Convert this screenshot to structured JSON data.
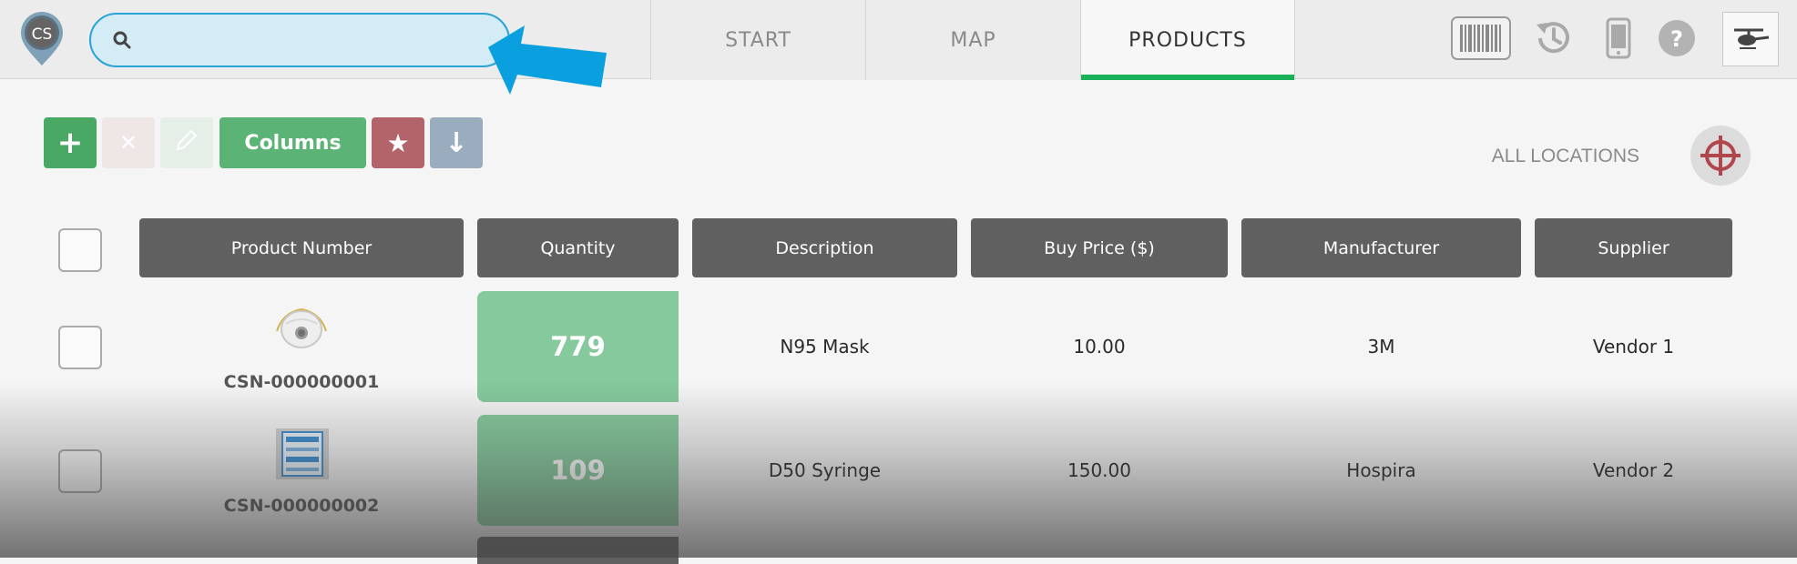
{
  "app": {
    "logo_text": "CS"
  },
  "search": {
    "placeholder": "",
    "value": ""
  },
  "tabs": [
    {
      "label": "START",
      "active": false
    },
    {
      "label": "MAP",
      "active": false
    },
    {
      "label": "PRODUCTS",
      "active": true
    }
  ],
  "header_icons": [
    "barcode-icon",
    "history-icon",
    "mobile-device-icon",
    "help-icon",
    "helicopter-icon"
  ],
  "toolbar": {
    "add_icon": "+",
    "delete_icon": "✕",
    "edit_icon": "pencil-icon",
    "columns_label": "Columns",
    "favorite_icon": "★",
    "download_icon": "↓"
  },
  "locations": {
    "label": "ALL LOCATIONS",
    "icon": "crosshair-icon"
  },
  "table": {
    "headers": [
      "Product Number",
      "Quantity",
      "Description",
      "Buy Price ($)",
      "Manufacturer",
      "Supplier"
    ],
    "rows": [
      {
        "product_number": "CSN-000000001",
        "quantity": "779",
        "description": "N95 Mask",
        "buy_price": "10.00",
        "manufacturer": "3M",
        "supplier": "Vendor 1",
        "image": "mask-image"
      },
      {
        "product_number": "CSN-000000002",
        "quantity": "109",
        "description": "D50 Syringe",
        "buy_price": "150.00",
        "manufacturer": "Hospira",
        "supplier": "Vendor 2",
        "image": "syringe-box-image"
      }
    ]
  },
  "colors": {
    "accent_green": "#19b159",
    "quantity_green": "#85c99c",
    "header_gray": "#606060",
    "search_blue": "#29a3d6",
    "arrow_blue": "#0aa0e0"
  }
}
